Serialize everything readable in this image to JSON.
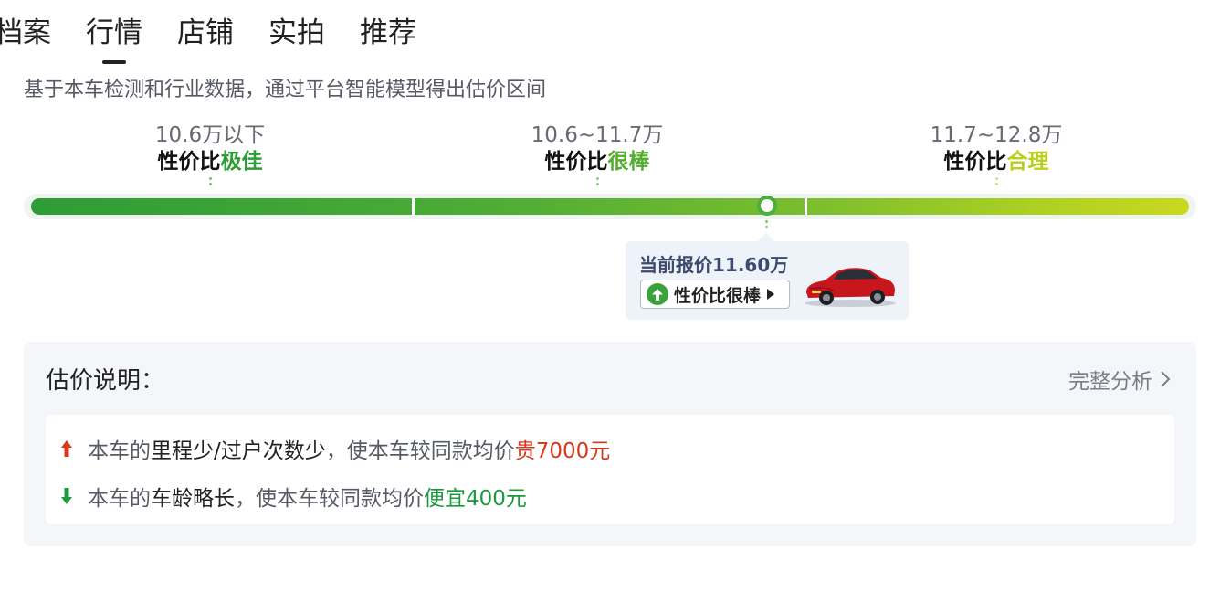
{
  "tabs": [
    {
      "label": "档案",
      "active": false
    },
    {
      "label": "行情",
      "active": true
    },
    {
      "label": "店铺",
      "active": false
    },
    {
      "label": "实拍",
      "active": false
    },
    {
      "label": "推荐",
      "active": false
    }
  ],
  "subtitle": "基于本车检测和行业数据，通过平台智能模型得出估价区间",
  "ranges": [
    {
      "price": "10.6万以下",
      "prefix": "性价比",
      "rating": "极佳",
      "color": "#2e9c36"
    },
    {
      "price": "10.6~11.7万",
      "prefix": "性价比",
      "rating": "很棒",
      "color": "#53ad2f"
    },
    {
      "price": "11.7~12.8万",
      "prefix": "性价比",
      "rating": "合理",
      "color": "#b8cf1e"
    }
  ],
  "current": {
    "price_label": "当前报价11.60万",
    "button_label": "性价比很棒"
  },
  "explain": {
    "title": "估价说明：",
    "link": "完整分析",
    "reasons": [
      {
        "direction": "up",
        "prefix": "本车的",
        "factor": "里程少/过户次数少",
        "middle": "，使本车较同款均价",
        "effect": "贵7000元",
        "color": "#d9371b"
      },
      {
        "direction": "down",
        "prefix": "本车的",
        "factor": "车龄略长",
        "middle": "，使本车较同款均价",
        "effect": "便宜400元",
        "color": "#1a9a3c"
      }
    ]
  },
  "colors": {
    "accent_green": "#3aa13d",
    "up_red": "#d9371b",
    "down_green": "#1a9a3c",
    "car_red": "#c8161d"
  }
}
